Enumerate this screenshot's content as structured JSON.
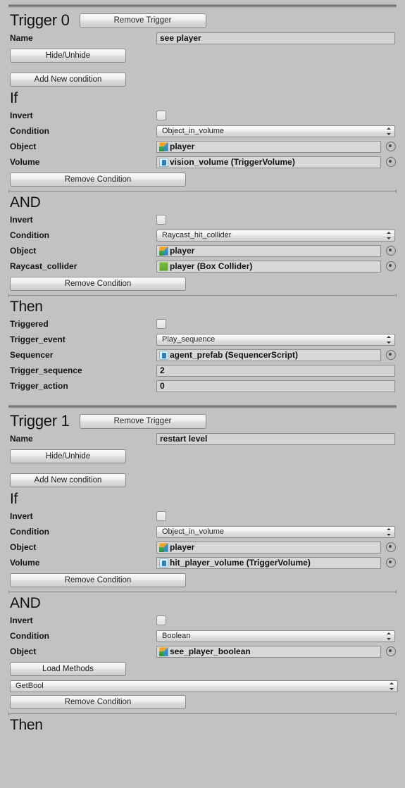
{
  "labels": {
    "name": "Name",
    "invert": "Invert",
    "condition": "Condition",
    "object": "Object",
    "volume": "Volume",
    "raycast_collider": "Raycast_collider",
    "triggered": "Triggered",
    "trigger_event": "Trigger_event",
    "sequencer": "Sequencer",
    "trigger_sequence": "Trigger_sequence",
    "trigger_action": "Trigger_action",
    "if": "If",
    "and": "AND",
    "then": "Then"
  },
  "buttons": {
    "remove_trigger": "Remove Trigger",
    "hide_unhide": "Hide/Unhide",
    "add_new_condition": "Add New condition",
    "remove_condition": "Remove Condition",
    "load_methods": "Load Methods"
  },
  "triggers": [
    {
      "title": "Trigger 0",
      "name_value": "see player",
      "conditions": [
        {
          "header": "If",
          "invert": false,
          "condition_value": "Object_in_volume",
          "fields": [
            {
              "label_key": "object",
              "label": "Object",
              "value": "player",
              "icon": "prefab-cube-icon"
            },
            {
              "label_key": "volume",
              "label": "Volume",
              "value": "vision_volume (TriggerVolume)",
              "icon": "script-icon"
            }
          ]
        },
        {
          "header": "AND",
          "invert": false,
          "condition_value": "Raycast_hit_collider",
          "fields": [
            {
              "label_key": "object",
              "label": "Object",
              "value": "player",
              "icon": "prefab-cube-icon"
            },
            {
              "label_key": "raycast_collider",
              "label": "Raycast_collider",
              "value": "player (Box Collider)",
              "icon": "collider-icon"
            }
          ]
        }
      ],
      "then": {
        "header": "Then",
        "triggered": false,
        "trigger_event": "Play_sequence",
        "sequencer": "agent_prefab (SequencerScript)",
        "sequencer_icon": "script-icon",
        "trigger_sequence": "2",
        "trigger_action": "0"
      }
    },
    {
      "title": "Trigger 1",
      "name_value": "restart level",
      "conditions": [
        {
          "header": "If",
          "invert": false,
          "condition_value": "Object_in_volume",
          "fields": [
            {
              "label_key": "object",
              "label": "Object",
              "value": "player",
              "icon": "prefab-cube-icon"
            },
            {
              "label_key": "volume",
              "label": "Volume",
              "value": "hit_player_volume (TriggerVolume)",
              "icon": "script-icon"
            }
          ]
        },
        {
          "header": "AND",
          "invert": false,
          "condition_value": "Boolean",
          "fields": [
            {
              "label_key": "object",
              "label": "Object",
              "value": "see_player_boolean",
              "icon": "prefab-cube-icon"
            }
          ],
          "method_dropdown": "GetBool"
        }
      ],
      "then": {
        "header": "Then"
      }
    }
  ],
  "colors": {
    "background": "#c2c2c2",
    "field_background": "#d7d7d7",
    "border": "#8c8c8c",
    "text": "#1c1c1c"
  }
}
